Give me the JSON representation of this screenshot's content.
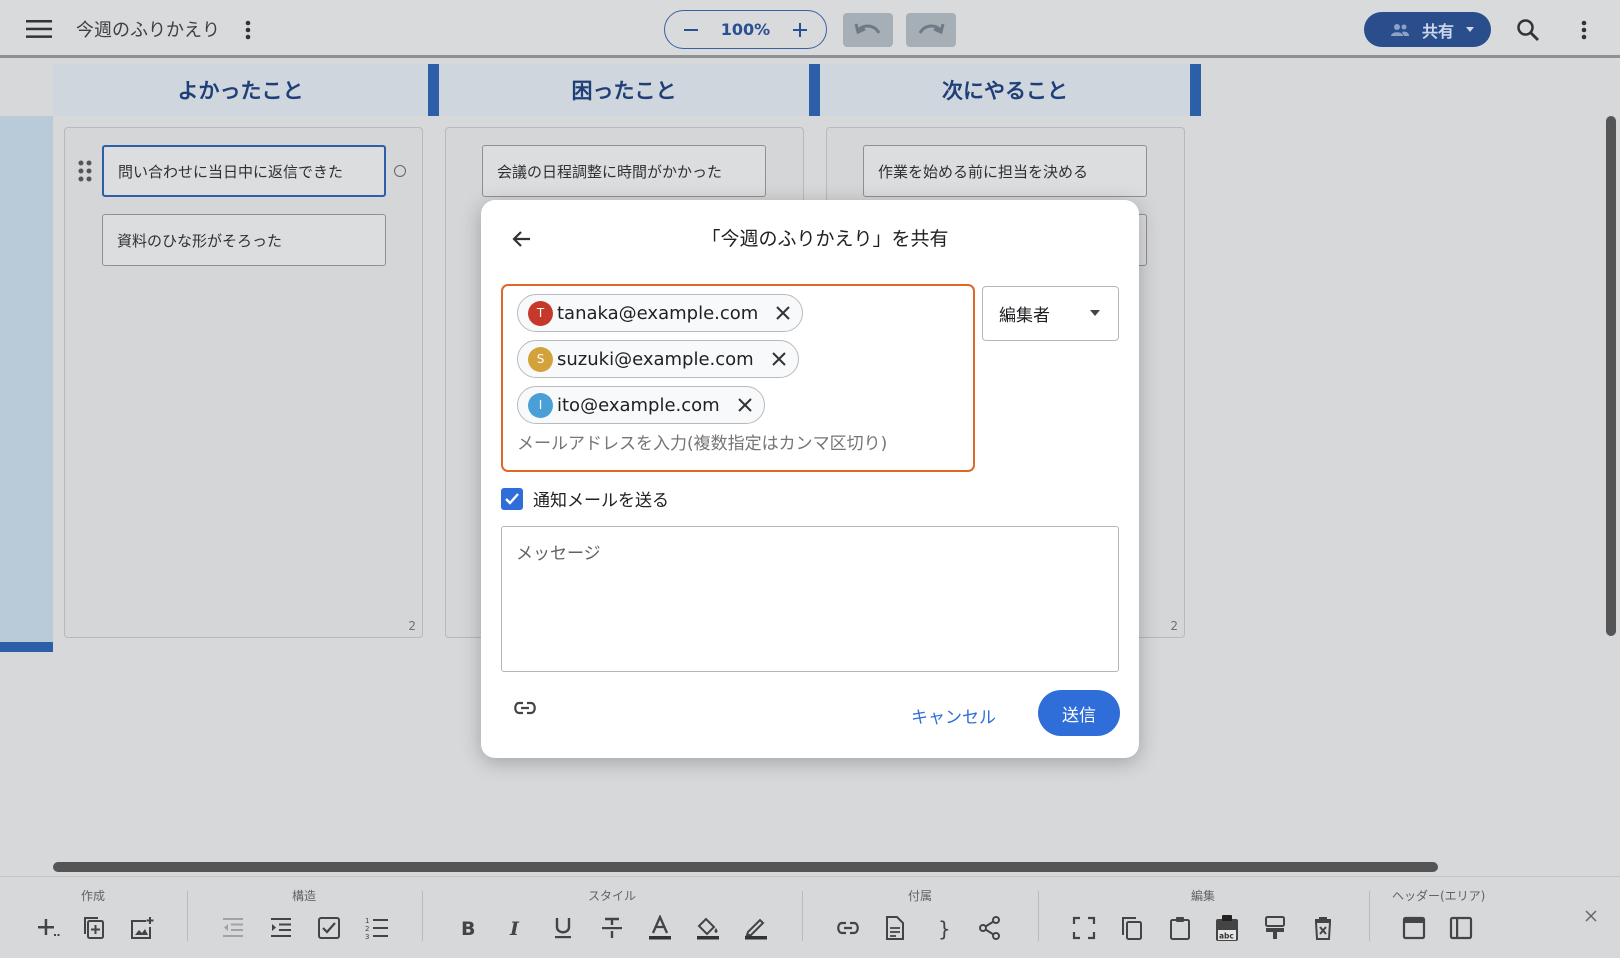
{
  "app": {
    "doc_title": "今週のふりかえり",
    "zoom": "100%",
    "share_label": "共有"
  },
  "board": {
    "columns": [
      {
        "title": "よかったこと",
        "cards": [
          "問い合わせに当日中に返信できた",
          "資料のひな形がそろった"
        ],
        "count": "2"
      },
      {
        "title": "困ったこと",
        "cards": [
          "会議の日程調整に時間がかかった"
        ],
        "count": ""
      },
      {
        "title": "次にやること",
        "cards": [
          "作業を始める前に担当を決める"
        ],
        "count": "2"
      }
    ]
  },
  "dialog": {
    "title": "「今週のふりかえり」を共有",
    "recipients": [
      {
        "initial": "T",
        "email": "tanaka@example.com",
        "color": "#c5392b"
      },
      {
        "initial": "S",
        "email": "suzuki@example.com",
        "color": "#d4a23a"
      },
      {
        "initial": "I",
        "email": "ito@example.com",
        "color": "#4a9fd6"
      }
    ],
    "email_placeholder": "メールアドレスを入力(複数指定はカンマ区切り)",
    "role": "編集者",
    "notify_label": "通知メールを送る",
    "message_placeholder": "メッセージ",
    "cancel_label": "キャンセル",
    "send_label": "送信"
  },
  "toolbar": {
    "groups": [
      "作成",
      "構造",
      "スタイル",
      "付属",
      "編集",
      "ヘッダー(エリア)"
    ]
  }
}
